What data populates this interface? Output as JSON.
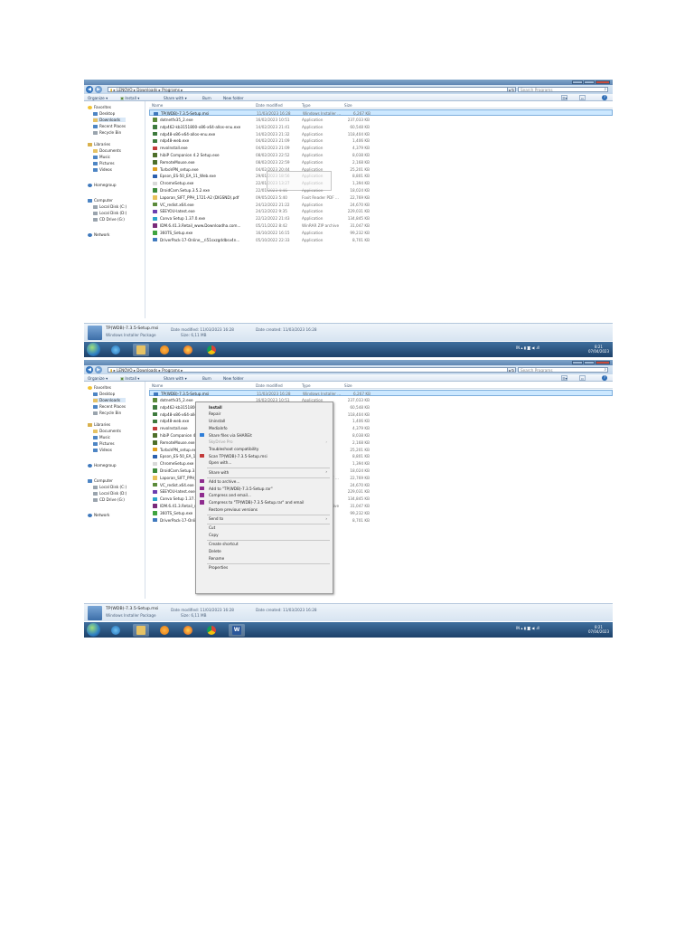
{
  "explorer": {
    "breadcrumb": [
      "LENOVO",
      "Downloads",
      "Programs"
    ],
    "search_placeholder": "Search Programs",
    "toolbar": {
      "organize": "Organize ▾",
      "install": "Install ▾",
      "share_with": "Share with ▾",
      "burn": "Burn",
      "new_folder": "New folder"
    },
    "nav": {
      "favorites": "Favorites",
      "fav_items": [
        "Desktop",
        "Downloads",
        "Recent Places",
        "Recycle Bin"
      ],
      "libraries": "Libraries",
      "lib_items": [
        "Documents",
        "Music",
        "Pictures",
        "Videos"
      ],
      "homegroup": "Homegroup",
      "computer": "Computer",
      "comp_items": [
        "Local Disk (C:)",
        "Local Disk (D:)",
        "CD Drive (G:)"
      ],
      "network": "Network"
    },
    "columns": {
      "name": "Name",
      "date_modified": "Date modified",
      "type": "Type",
      "size": "Size"
    },
    "files": [
      {
        "name": "TP(WDB)-7.3.5-Setup.msi",
        "date": "11/03/2023 16:28",
        "type": "Windows Installer ...",
        "size": "6,267 KB",
        "color": "#3f79bd"
      },
      {
        "name": "dotnetfx35_2.exe",
        "date": "16/02/2023 10:51",
        "type": "Application",
        "size": "237,033 KB",
        "color": "#5b8a3a"
      },
      {
        "name": "ndp462-kb3151800-x86-x64-allos-enu.exe",
        "date": "14/02/2023 21:41",
        "type": "Application",
        "size": "60,548 KB",
        "color": "#3d7a3d"
      },
      {
        "name": "ndp48-x86-x64-allos-enu.exe",
        "date": "14/02/2023 21:32",
        "type": "Application",
        "size": "118,404 KB",
        "color": "#3d7a3d"
      },
      {
        "name": "ndp48-web.exe",
        "date": "04/02/2023 21:09",
        "type": "Application",
        "size": "1,406 KB",
        "color": "#3d7a3d"
      },
      {
        "name": "revoInstall.exe",
        "date": "04/02/2023 21:09",
        "type": "Application",
        "size": "4,379 KB",
        "color": "#c23a3a"
      },
      {
        "name": "hibiP Companion 4.2 Setup.exe",
        "date": "08/02/2023 22:52",
        "type": "Application",
        "size": "8,038 KB",
        "color": "#4e6f2a"
      },
      {
        "name": "RemoteMouse.exe",
        "date": "08/02/2023 22:59",
        "type": "Application",
        "size": "2,168 KB",
        "color": "#4e6f2a"
      },
      {
        "name": "TurboVPN_setup.exe",
        "date": "04/02/2023 20:44",
        "type": "Application",
        "size": "25,201 KB",
        "color": "#e0a020"
      },
      {
        "name": "Epson_ES-50_EA_11_Web.exe",
        "date": "29/01/2023 18:56",
        "type": "Application",
        "size": "8,801 KB",
        "color": "#2b5fae"
      },
      {
        "name": "ChromeSetup.exe",
        "date": "22/01/2023 13:27",
        "type": "Application",
        "size": "1,394 KB",
        "color": "#d9d9d9"
      },
      {
        "name": "DroidCam.Setup.3.5.2.exe",
        "date": "22/01/2023 4:46",
        "type": "Application",
        "size": "18,024 KB",
        "color": "#3b8a3b"
      },
      {
        "name": "Laporan_SIFT_PPH_1721-A2 (DIGSND).pdf",
        "date": "09/05/2023 5:40",
        "type": "Foxit Reader PDF ...",
        "size": "22,769 KB",
        "color": "#e8c15a"
      },
      {
        "name": "VC_redist.x64.exe",
        "date": "24/12/2022 21:22",
        "type": "Application",
        "size": "24,670 KB",
        "color": "#5b8a3a"
      },
      {
        "name": "SEEYOU-latest.exe",
        "date": "24/12/2022 9:35",
        "type": "Application",
        "size": "229,031 KB",
        "color": "#6a3fb0"
      },
      {
        "name": "Canva Setup 1.37.0.exe",
        "date": "22/12/2022 21:43",
        "type": "Application",
        "size": "134,845 KB",
        "color": "#2ba4c9"
      },
      {
        "name": "IDM.6.41.3.Retail_www.Downloadha.com...",
        "date": "05/11/2022 8:42",
        "type": "WinRAR ZIP archive",
        "size": "31,047 KB",
        "color": "#7a2a7a"
      },
      {
        "name": "360TS_Setup.exe",
        "date": "16/10/2022 16:15",
        "type": "Application",
        "size": "99,232 KB",
        "color": "#3fa33f"
      },
      {
        "name": "DriverPack-17-Online__ri51sxzgddbsv4n...",
        "date": "05/10/2022 22:33",
        "type": "Application",
        "size": "8,701 KB",
        "color": "#3f79bd"
      }
    ],
    "details": {
      "filename": "TP(WDB)-7.3.5-Setup.msi",
      "date_modified": "Date modified: 11/03/2023 16:28",
      "date_created": "Date created: 11/03/2023 16:28",
      "type": "Windows Installer Package",
      "size": "Size: 6,11 MB"
    }
  },
  "taskbar": {
    "tray": "IN  ▴  ▮ ◙ ◀ .ıll",
    "time": "8:21",
    "date": "07/04/2023",
    "word_label": "W"
  },
  "context_menu": {
    "items": [
      {
        "label": "Install",
        "style": "bold"
      },
      {
        "label": "Repair",
        "style": ""
      },
      {
        "label": "Uninstall",
        "style": ""
      },
      {
        "label": "MediaInfo",
        "style": ""
      },
      {
        "label": "Share files via SHAREit",
        "style": "",
        "icon": "#2f7ed8"
      },
      {
        "label": "SkyDrive Pro",
        "style": "disabled",
        "arrow": "›"
      },
      {
        "label": "Troubleshoot compatibility",
        "style": ""
      },
      {
        "label": "Scan TP(WDB)-7.3.5-Setup.msi",
        "style": "",
        "icon": "#c23a3a"
      },
      {
        "label": "Open with...",
        "style": ""
      },
      {
        "label": "Share with",
        "style": "",
        "arrow": "›",
        "sep_before": true
      },
      {
        "label": "Add to archive...",
        "style": "",
        "icon": "#8e2b8e",
        "sep_before": true
      },
      {
        "label": "Add to \"TP(WDB)-7.3.5-Setup.rar\"",
        "style": "",
        "icon": "#8e2b8e"
      },
      {
        "label": "Compress and email...",
        "style": "",
        "icon": "#8e2b8e"
      },
      {
        "label": "Compress to \"TP(WDB)-7.3.5-Setup.rar\" and email",
        "style": "",
        "icon": "#8e2b8e"
      },
      {
        "label": "Restore previous versions",
        "style": ""
      },
      {
        "label": "Send to",
        "style": "",
        "arrow": "›",
        "sep_before": true
      },
      {
        "label": "Cut",
        "style": "",
        "sep_before": true
      },
      {
        "label": "Copy",
        "style": ""
      },
      {
        "label": "Create shortcut",
        "style": "",
        "sep_before": true
      },
      {
        "label": "Delete",
        "style": ""
      },
      {
        "label": "Rename",
        "style": ""
      },
      {
        "label": "Properties",
        "style": "",
        "sep_before": true
      }
    ]
  },
  "colors": {
    "selection": "#cce8ff",
    "taskbar": "#1d4169",
    "titlebar": "#5f86b3"
  }
}
